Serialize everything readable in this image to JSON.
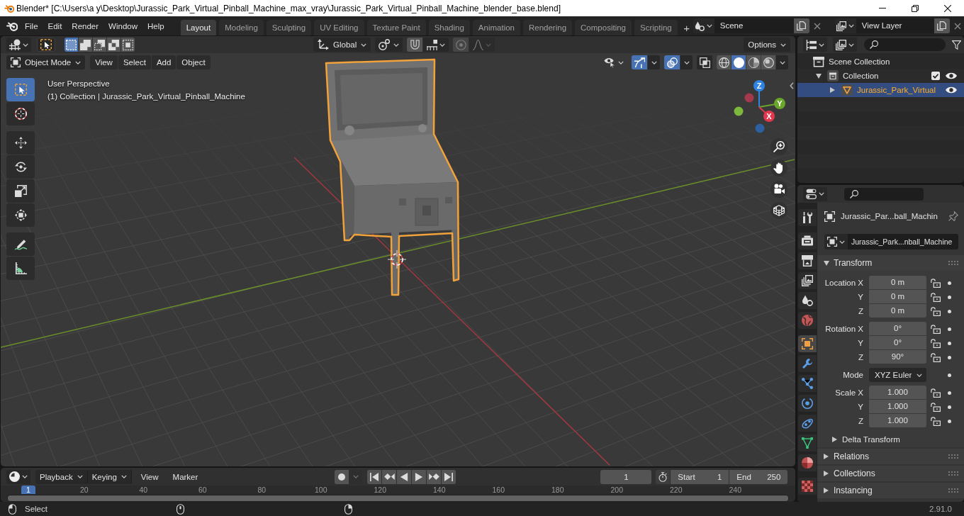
{
  "window": {
    "title": "Blender* [C:\\Users\\a y\\Desktop\\Jurassic_Park_Virtual_Pinball_Machine_max_vray\\Jurassic_Park_Virtual_Pinball_Machine_blender_base.blend]"
  },
  "menu_bar": [
    "File",
    "Edit",
    "Render",
    "Window",
    "Help"
  ],
  "workspace_tabs": [
    {
      "label": "Layout",
      "selected": true
    },
    {
      "label": "Modeling",
      "selected": false
    },
    {
      "label": "Sculpting",
      "selected": false
    },
    {
      "label": "UV Editing",
      "selected": false
    },
    {
      "label": "Texture Paint",
      "selected": false
    },
    {
      "label": "Shading",
      "selected": false
    },
    {
      "label": "Animation",
      "selected": false
    },
    {
      "label": "Rendering",
      "selected": false
    },
    {
      "label": "Compositing",
      "selected": false
    },
    {
      "label": "Scripting",
      "selected": false
    }
  ],
  "add_workspace": "+",
  "scene": "Scene",
  "view_layer": "View Layer",
  "tool_settings": {
    "select_modes": [
      {
        "kind": "set",
        "selected": true
      },
      {
        "kind": "extend",
        "selected": false
      },
      {
        "kind": "subtract",
        "selected": false
      },
      {
        "kind": "difference",
        "selected": false
      },
      {
        "kind": "intersect",
        "selected": false
      }
    ],
    "orientation": "Global",
    "options": "Options"
  },
  "viewport": {
    "mode": "Object Mode",
    "menus": [
      "View",
      "Select",
      "Add",
      "Object"
    ],
    "toggles": [
      {
        "kind": "gizmos",
        "on": true
      },
      {
        "kind": "overlays",
        "on": true
      },
      {
        "kind": "xray",
        "on": false
      }
    ],
    "shading": [
      {
        "kind": "wireframe",
        "selected": false
      },
      {
        "kind": "solid",
        "selected": true
      },
      {
        "kind": "material",
        "selected": false
      },
      {
        "kind": "rendered",
        "selected": false
      }
    ],
    "tool_groups": [
      {
        "tools": [
          {
            "kind": "select-box",
            "selected": true
          },
          {
            "kind": "cursor",
            "selected": false
          }
        ]
      },
      {
        "tools": [
          {
            "kind": "move",
            "selected": false
          },
          {
            "kind": "rotate",
            "selected": false
          },
          {
            "kind": "scale",
            "selected": false
          },
          {
            "kind": "transform",
            "selected": false
          }
        ]
      },
      {
        "tools": [
          {
            "kind": "annotate",
            "selected": false
          },
          {
            "kind": "measure",
            "selected": false
          }
        ]
      }
    ],
    "view_name": "User Perspective",
    "context": "(1) Collection | Jurassic_Park_Virtual_Pinball_Machine",
    "gizmo_axes": [
      {
        "label": "Z",
        "color": "#2f84e3"
      },
      {
        "label": "Y",
        "color": "#6aa52c"
      },
      {
        "label": "X",
        "color": "#e3374e"
      }
    ]
  },
  "outliner": {
    "tree": [
      {
        "label": "Scene Collection",
        "kind": "scene-collection",
        "selected": false,
        "children": [
          {
            "label": "Collection",
            "kind": "collection",
            "expanded": true,
            "checked": true,
            "visible": true,
            "selected": false,
            "children": [
              {
                "label": "Jurassic_Park_Virtual",
                "kind": "mesh-object",
                "expanded": false,
                "visible": true,
                "selected": true
              }
            ]
          }
        ]
      }
    ]
  },
  "properties": {
    "tab_groups": [
      {
        "tabs": [
          {
            "kind": "tool",
            "selected": false
          }
        ]
      },
      {
        "tabs": [
          {
            "kind": "render",
            "selected": false
          },
          {
            "kind": "output",
            "selected": false
          },
          {
            "kind": "view-layer",
            "selected": false
          },
          {
            "kind": "scene",
            "selected": false
          },
          {
            "kind": "world",
            "selected": false
          }
        ]
      },
      {
        "tabs": [
          {
            "kind": "object",
            "selected": true
          },
          {
            "kind": "modifiers",
            "selected": false
          },
          {
            "kind": "particles",
            "selected": false
          },
          {
            "kind": "physics",
            "selected": false
          },
          {
            "kind": "constraints",
            "selected": false
          },
          {
            "kind": "data",
            "selected": false
          },
          {
            "kind": "material",
            "selected": false
          }
        ]
      },
      {
        "tabs": [
          {
            "kind": "texture",
            "selected": false
          }
        ]
      }
    ],
    "context": "Jurassic_Par...ball_Machin",
    "object_name": "Jurassic_Park...nball_Machine",
    "panels": [
      {
        "title": "Transform",
        "expanded": true,
        "groups": [
          {
            "kind": "vector",
            "rows": [
              {
                "label": "Location X",
                "value": "0 m",
                "locked": false
              },
              {
                "label": "Y",
                "value": "0 m",
                "locked": false
              },
              {
                "label": "Z",
                "value": "0 m",
                "locked": false
              }
            ]
          },
          {
            "kind": "vector",
            "rows": [
              {
                "label": "Rotation X",
                "value": "0°",
                "locked": false
              },
              {
                "label": "Y",
                "value": "0°",
                "locked": false
              },
              {
                "label": "Z",
                "value": "90°",
                "locked": false
              }
            ]
          },
          {
            "kind": "dropdown",
            "label": "Mode",
            "value": "XYZ Euler"
          },
          {
            "kind": "vector",
            "rows": [
              {
                "label": "Scale X",
                "value": "1.000",
                "locked": false
              },
              {
                "label": "Y",
                "value": "1.000",
                "locked": false
              },
              {
                "label": "Z",
                "value": "1.000",
                "locked": false
              }
            ]
          }
        ],
        "subpanels": [
          {
            "title": "Delta Transform",
            "expanded": false
          }
        ]
      },
      {
        "title": "Relations",
        "expanded": false
      },
      {
        "title": "Collections",
        "expanded": false
      },
      {
        "title": "Instancing",
        "expanded": false
      }
    ]
  },
  "timeline": {
    "menus": [
      {
        "kind": "dropdown",
        "label": "Playback"
      },
      {
        "kind": "dropdown",
        "label": "Keying"
      },
      {
        "kind": "menu",
        "label": "View"
      },
      {
        "kind": "menu",
        "label": "Marker"
      }
    ],
    "current_frame": "1",
    "start": {
      "label": "Start",
      "value": "1"
    },
    "end": {
      "label": "End",
      "value": "250"
    },
    "playhead": "1",
    "ruler": [
      "20",
      "40",
      "60",
      "80",
      "100",
      "120",
      "140",
      "160",
      "180",
      "200",
      "220",
      "240"
    ]
  },
  "status_bar": {
    "hints": [
      {
        "kind": "left-mouse",
        "label": "Select"
      },
      {
        "kind": "middle-mouse"
      },
      {
        "kind": "right-mouse"
      }
    ],
    "version": "2.91.0"
  }
}
